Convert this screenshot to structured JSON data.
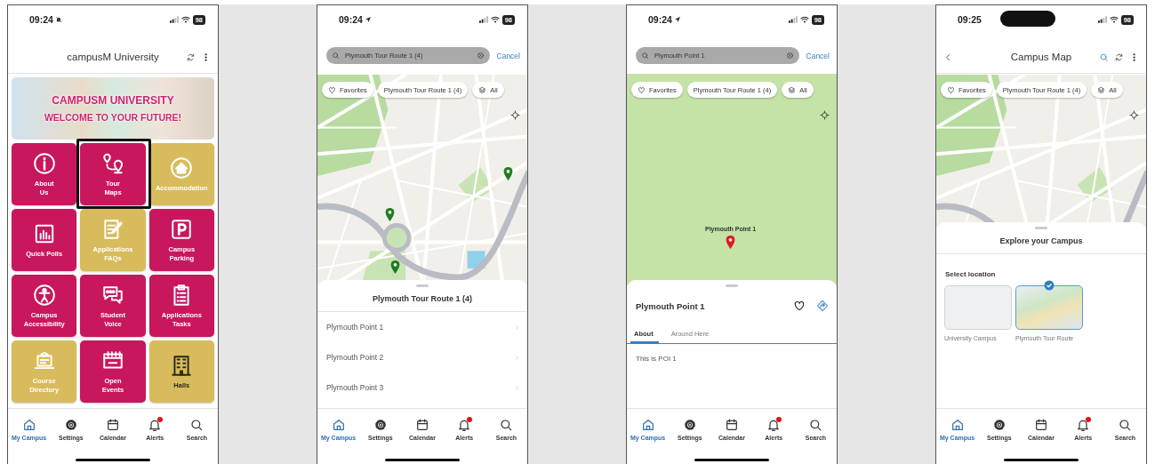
{
  "phones": [
    {
      "status_bar": {
        "time": "09:24",
        "kind": "silent",
        "battery": "98"
      },
      "header": {
        "kind": "title",
        "back": false,
        "search": false,
        "title": "campusM University"
      },
      "body": {
        "kind": "home",
        "banner": {
          "title": "CAMPUSM UNIVERSITY",
          "subtitle": "WELCOME TO YOUR FUTURE!"
        },
        "tiles": [
          {
            "label_lines": [
              "About",
              "Us"
            ],
            "color": "#c8175d",
            "dark_label": false,
            "highlighted": false
          },
          {
            "label_lines": [
              "Tour",
              "Maps"
            ],
            "color": "#c8175d",
            "dark_label": false,
            "highlighted": true
          },
          {
            "label_lines": [
              "Accommodation"
            ],
            "color": "#d8bb5c",
            "dark_label": false,
            "highlighted": false
          },
          {
            "label_lines": [
              "Quick Polls"
            ],
            "color": "#c8175d",
            "dark_label": false,
            "highlighted": false
          },
          {
            "label_lines": [
              "Applications",
              "FAQs"
            ],
            "color": "#d8bb5c",
            "dark_label": false,
            "highlighted": false
          },
          {
            "label_lines": [
              "Campus",
              "Parking"
            ],
            "color": "#c8175d",
            "dark_label": false,
            "highlighted": false
          },
          {
            "label_lines": [
              "Campus",
              "Accessibility"
            ],
            "color": "#c8175d",
            "dark_label": false,
            "highlighted": false
          },
          {
            "label_lines": [
              "Student",
              "Voice"
            ],
            "color": "#c8175d",
            "dark_label": false,
            "highlighted": false
          },
          {
            "label_lines": [
              "Applications",
              "Tasks"
            ],
            "color": "#c8175d",
            "dark_label": false,
            "highlighted": false
          },
          {
            "label_lines": [
              "Course",
              "Directory"
            ],
            "color": "#d8bb5c",
            "dark_label": false,
            "highlighted": false
          },
          {
            "label_lines": [
              "Open",
              "Events"
            ],
            "color": "#c8175d",
            "dark_label": false,
            "highlighted": false
          },
          {
            "label_lines": [
              "Halls"
            ],
            "color": "#d8bb5c",
            "dark_label": true,
            "highlighted": false
          }
        ]
      },
      "tab_bar": [
        {
          "label": "My Campus",
          "selected": true,
          "badge": false
        },
        {
          "label": "Settings",
          "selected": false,
          "badge": false
        },
        {
          "label": "Calendar",
          "selected": false,
          "badge": false
        },
        {
          "label": "Alerts",
          "selected": false,
          "badge": true
        },
        {
          "label": "Search",
          "selected": false,
          "badge": false
        }
      ]
    },
    {
      "status_bar": {
        "time": "09:24",
        "kind": "location",
        "battery": "98"
      },
      "header": {
        "kind": "search",
        "query": "Plymouth Tour Route 1 (4)",
        "cancel": "Cancel"
      },
      "body": {
        "kind": "map",
        "map": {
          "kind": "streets",
          "chips": [
            {
              "label": "Favorites"
            },
            {
              "label": "Plymouth Tour Route 1 (4)"
            },
            {
              "label": "All"
            }
          ],
          "pins": [
            {
              "color": "#1e7d1e"
            },
            {
              "color": "#1e7d1e"
            },
            {
              "color": "#1e7d1e"
            }
          ]
        },
        "sheet": {
          "kind": "list",
          "title": "Plymouth Tour Route 1 (4)",
          "items": [
            {
              "label": "Plymouth Point 1"
            },
            {
              "label": "Plymouth Point 2"
            },
            {
              "label": "Plymouth Point 3"
            }
          ]
        }
      },
      "tab_bar": [
        {
          "label": "My Campus",
          "selected": true,
          "badge": false
        },
        {
          "label": "Settings",
          "selected": false,
          "badge": false
        },
        {
          "label": "Calendar",
          "selected": false,
          "badge": false
        },
        {
          "label": "Alerts",
          "selected": false,
          "badge": true
        },
        {
          "label": "Search",
          "selected": false,
          "badge": false
        }
      ]
    },
    {
      "status_bar": {
        "time": "09:24",
        "kind": "location",
        "battery": "98"
      },
      "header": {
        "kind": "search",
        "query": "Plymouth Point 1",
        "cancel": "Cancel"
      },
      "body": {
        "kind": "map",
        "map": {
          "kind": "park",
          "chips": [
            {
              "label": "Favorites"
            },
            {
              "label": "Plymouth Tour Route 1 (4)"
            },
            {
              "label": "All"
            }
          ],
          "pins": [
            {
              "color": "#e5161d",
              "label": "Plymouth Point 1"
            }
          ]
        },
        "sheet": {
          "kind": "detail",
          "title": "Plymouth Point 1",
          "tabs": [
            {
              "label": "About",
              "selected": true
            },
            {
              "label": "Around Here",
              "selected": false
            }
          ],
          "text": "This is POI 1"
        }
      },
      "tab_bar": [
        {
          "label": "My Campus",
          "selected": true,
          "badge": false
        },
        {
          "label": "Settings",
          "selected": false,
          "badge": false
        },
        {
          "label": "Calendar",
          "selected": false,
          "badge": false
        },
        {
          "label": "Alerts",
          "selected": false,
          "badge": true
        },
        {
          "label": "Search",
          "selected": false,
          "badge": false
        }
      ]
    },
    {
      "status_bar": {
        "time": "09:25",
        "kind": "notch",
        "battery": "98"
      },
      "header": {
        "kind": "title",
        "back": true,
        "search": true,
        "title": "Campus Map"
      },
      "body": {
        "kind": "map",
        "map": {
          "kind": "streets",
          "chips": [
            {
              "label": "Favorites"
            },
            {
              "label": "Plymouth Tour Route 1 (4)"
            },
            {
              "label": "All"
            }
          ]
        },
        "sheet": {
          "kind": "locations",
          "title": "Explore your Campus",
          "section": "Select location",
          "options": [
            {
              "label": "University Campus",
              "selected": false
            },
            {
              "label": "Plymouth Tour Route",
              "selected": true
            }
          ]
        }
      },
      "tab_bar": [
        {
          "label": "My Campus",
          "selected": true,
          "badge": false
        },
        {
          "label": "Settings",
          "selected": false,
          "badge": false
        },
        {
          "label": "Calendar",
          "selected": false,
          "badge": false
        },
        {
          "label": "Alerts",
          "selected": false,
          "badge": true
        },
        {
          "label": "Search",
          "selected": false,
          "badge": false
        }
      ]
    }
  ]
}
